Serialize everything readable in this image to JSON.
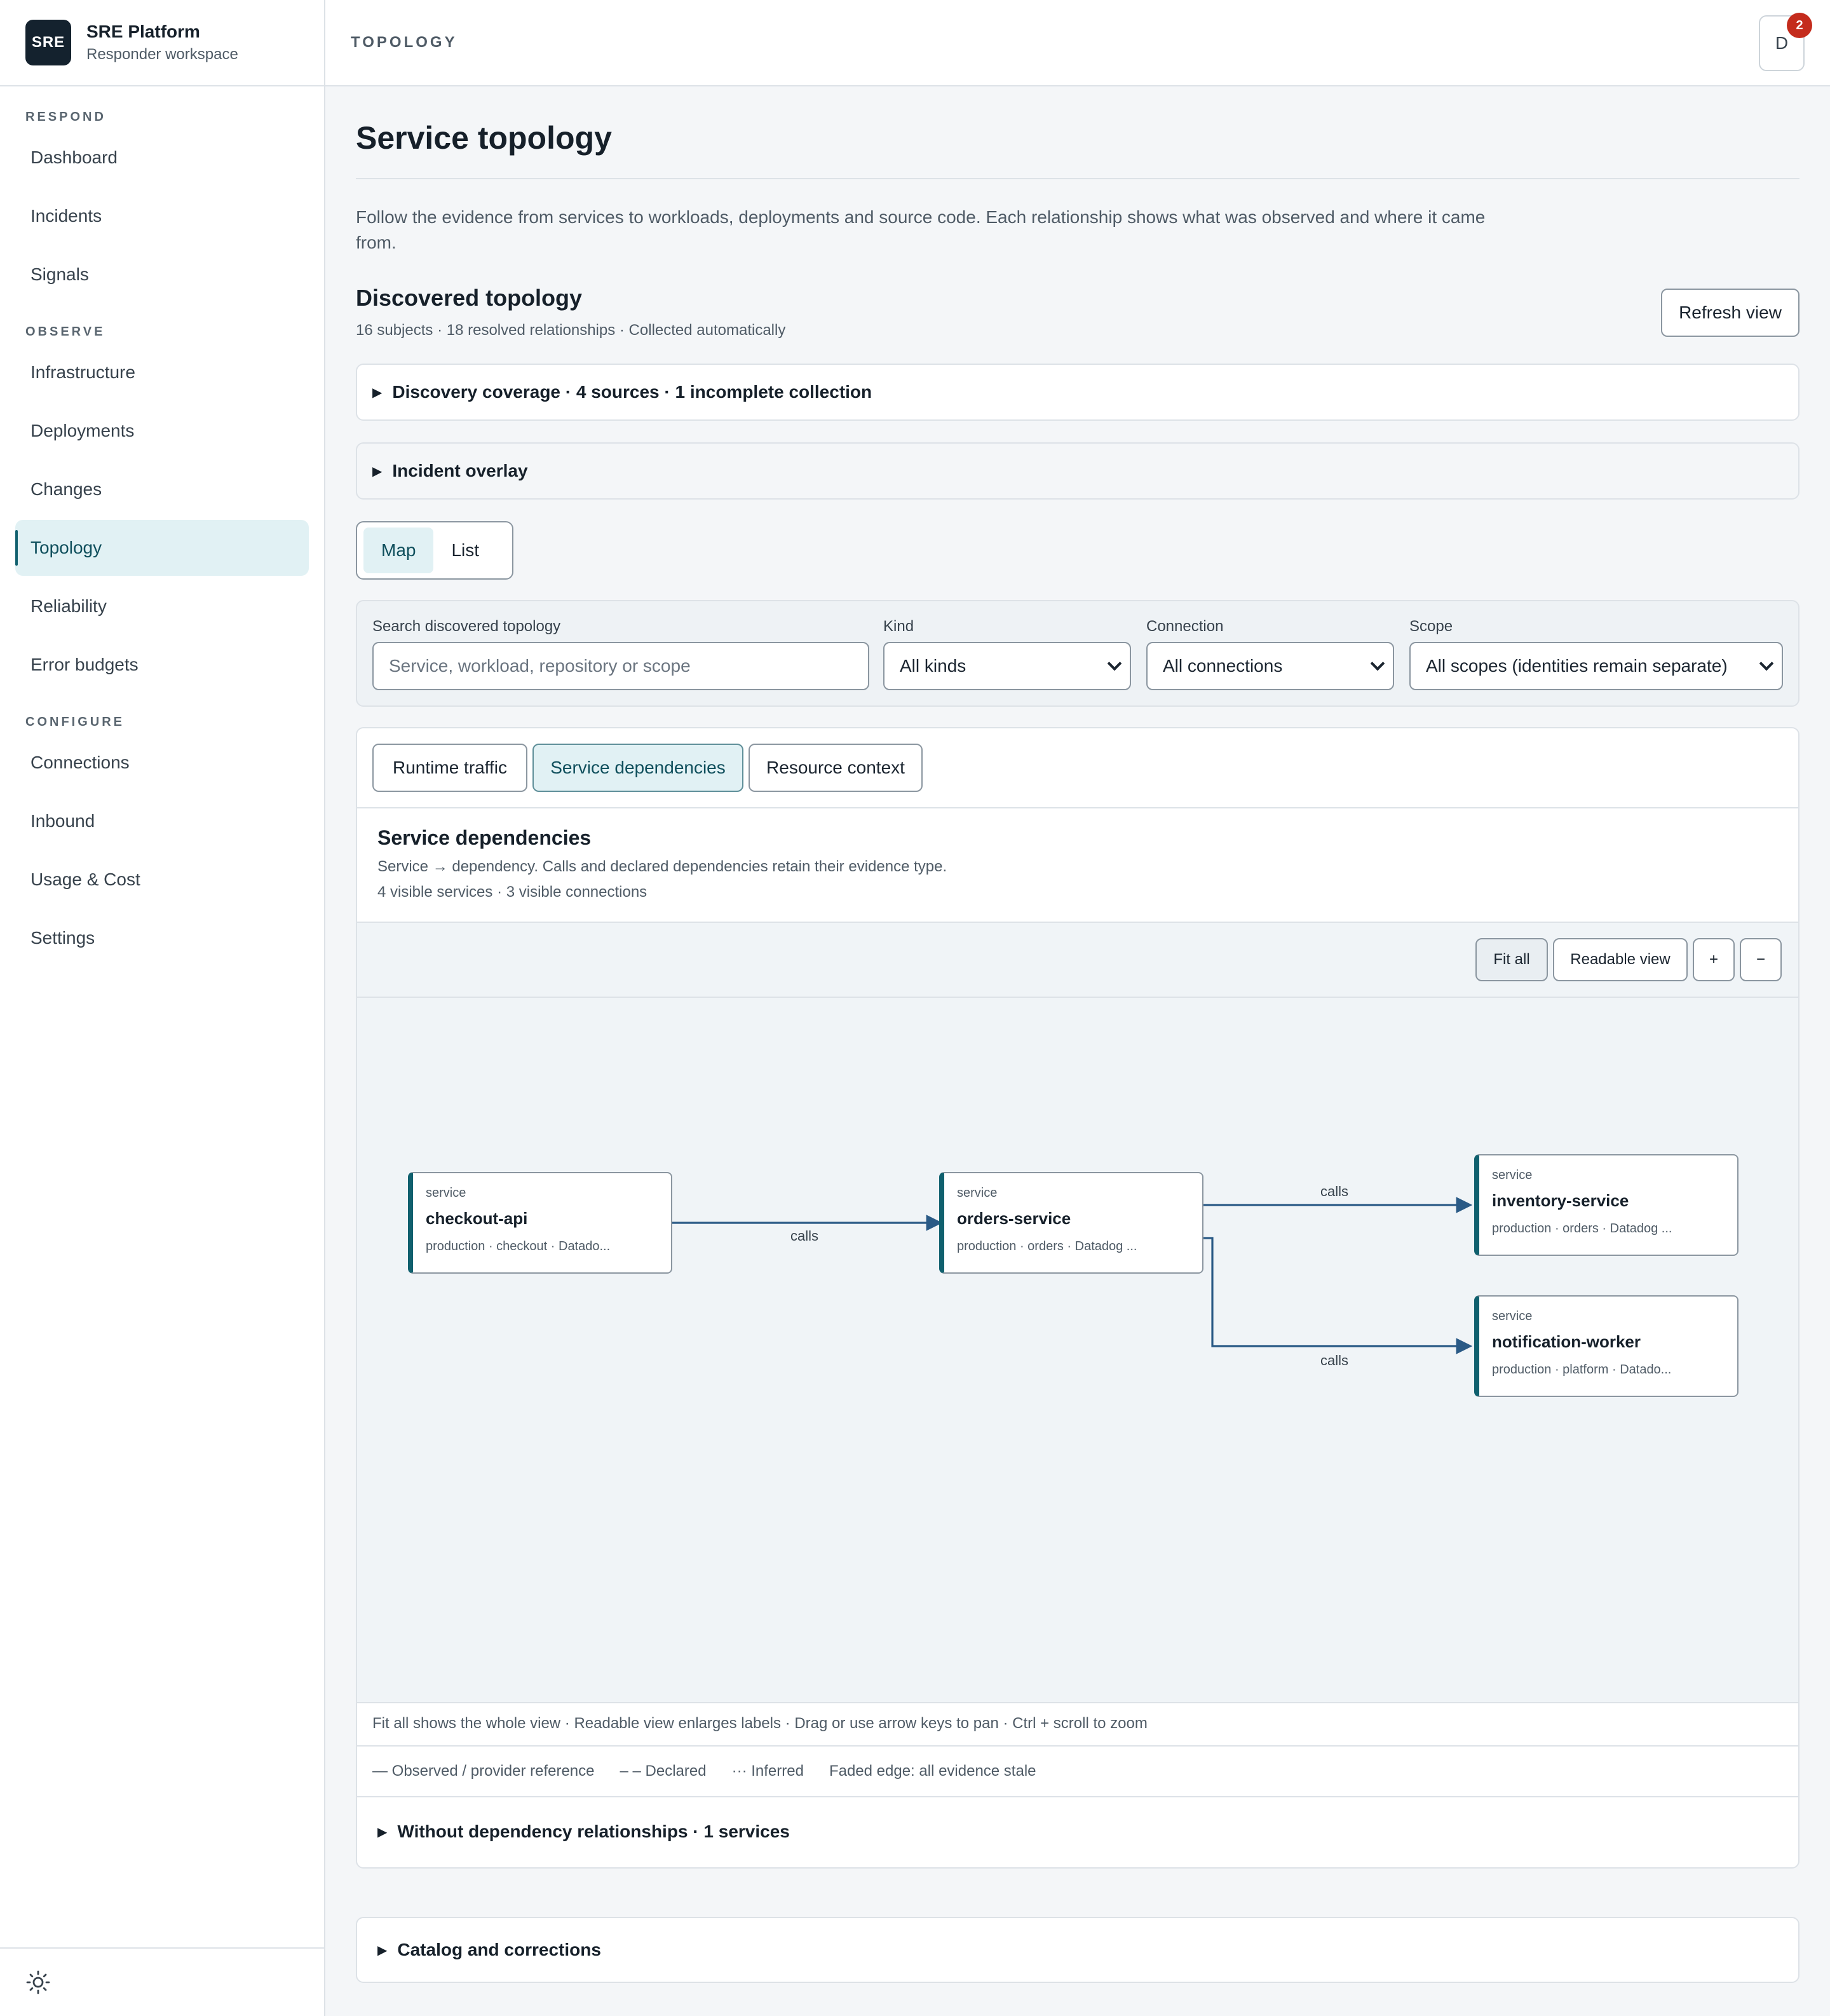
{
  "brand": {
    "logo": "SRE",
    "title": "SRE Platform",
    "subtitle": "Responder workspace"
  },
  "sidebar": {
    "sections": [
      {
        "label": "RESPOND",
        "items": [
          {
            "label": "Dashboard"
          },
          {
            "label": "Incidents"
          },
          {
            "label": "Signals"
          }
        ]
      },
      {
        "label": "OBSERVE",
        "items": [
          {
            "label": "Infrastructure"
          },
          {
            "label": "Deployments"
          },
          {
            "label": "Changes"
          },
          {
            "label": "Topology",
            "active": true
          },
          {
            "label": "Reliability"
          },
          {
            "label": "Error budgets"
          }
        ]
      },
      {
        "label": "CONFIGURE",
        "items": [
          {
            "label": "Connections"
          },
          {
            "label": "Inbound"
          },
          {
            "label": "Usage & Cost"
          },
          {
            "label": "Settings"
          }
        ]
      }
    ],
    "theme_icon": "sun-icon"
  },
  "header": {
    "breadcrumb": "TOPOLOGY",
    "avatar_initial": "D",
    "notification_count": "2"
  },
  "page": {
    "title": "Service topology",
    "intro": "Follow the evidence from services to workloads, deployments and source code. Each relationship shows what was observed and where it came from.",
    "discovered_title": "Discovered topology",
    "discovered_summary": "16 subjects · 18 resolved relationships · Collected automatically",
    "refresh_label": "Refresh view",
    "coverage_summary": "Discovery coverage · 4 sources · 1 incomplete collection",
    "overlay_summary": "Incident overlay",
    "view_modes": [
      "Map",
      "List"
    ],
    "active_view_mode": "Map"
  },
  "filters": {
    "search": {
      "label": "Search discovered topology",
      "placeholder": "Service, workload, repository or scope"
    },
    "kind": {
      "label": "Kind",
      "value": "All kinds"
    },
    "connection": {
      "label": "Connection",
      "value": "All connections"
    },
    "scope": {
      "label": "Scope",
      "value": "All scopes (identities remain separate)"
    }
  },
  "topology": {
    "tabs": [
      "Runtime traffic",
      "Service dependencies",
      "Resource context"
    ],
    "active_tab": "Service dependencies",
    "section_title": "Service dependencies",
    "description": "Service → dependency. Calls and declared dependencies retain their evidence type.",
    "visible_counts": "4 visible services · 3 visible connections",
    "toolbar": {
      "fit_all": "Fit all",
      "readable": "Readable view",
      "zoom_in": "+",
      "zoom_out": "−"
    },
    "nodes": [
      {
        "kind": "service",
        "name": "checkout-api",
        "meta": "production · checkout · Datado..."
      },
      {
        "kind": "service",
        "name": "orders-service",
        "meta": "production · orders · Datadog ..."
      },
      {
        "kind": "service",
        "name": "inventory-service",
        "meta": "production · orders · Datadog ..."
      },
      {
        "kind": "service",
        "name": "notification-worker",
        "meta": "production · platform · Datado..."
      }
    ],
    "edges": [
      {
        "from": "checkout-api",
        "to": "orders-service",
        "label": "calls"
      },
      {
        "from": "orders-service",
        "to": "inventory-service",
        "label": "calls"
      },
      {
        "from": "orders-service",
        "to": "notification-worker",
        "label": "calls"
      }
    ],
    "hint": "Fit all shows the whole view · Readable view enlarges labels · Drag or use arrow keys to pan · Ctrl + scroll to zoom",
    "legend": [
      "— Observed / provider reference",
      "– – Declared",
      "··· Inferred",
      "Faded edge: all evidence stale"
    ],
    "without_summary": "Without dependency relationships · 1 services"
  },
  "catalog_summary": "Catalog and corrections",
  "colors": {
    "accent": "#10606e",
    "active_bg": "#e1f1f4",
    "edge": "#2a5a86",
    "badge": "#c42b1c"
  }
}
